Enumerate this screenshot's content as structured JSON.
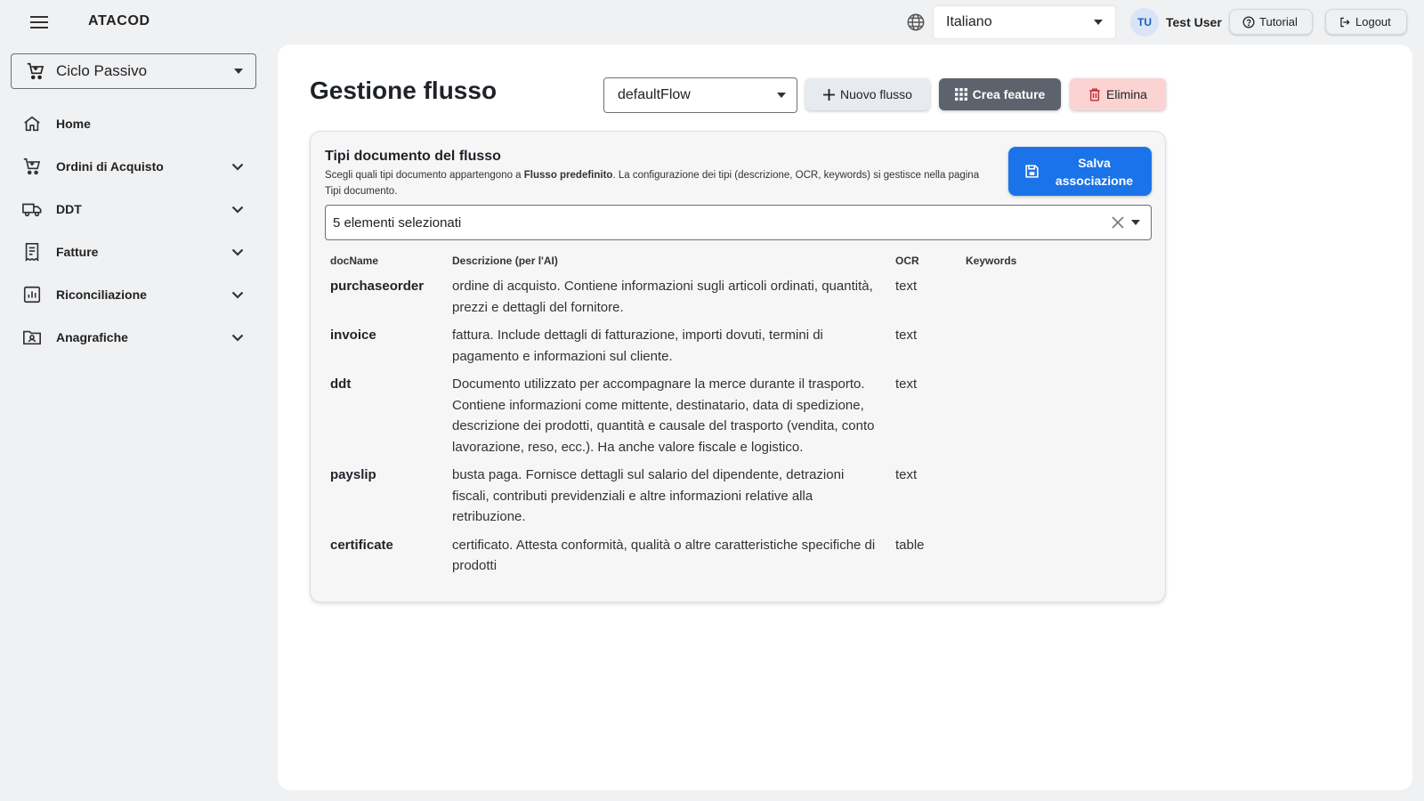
{
  "header": {
    "app_title": "ATACOD",
    "language": "Italiano",
    "avatar_initials": "TU",
    "user_name": "Test User",
    "tutorial_label": "Tutorial",
    "logout_label": "Logout"
  },
  "sidebar": {
    "context": "Ciclo Passivo",
    "items": [
      {
        "label": "Home",
        "icon": "home-icon"
      },
      {
        "label": "Ordini di Acquisto",
        "icon": "cart-icon"
      },
      {
        "label": "DDT",
        "icon": "truck-icon"
      },
      {
        "label": "Fatture",
        "icon": "receipt-icon"
      },
      {
        "label": "Riconciliazione",
        "icon": "chart-icon"
      },
      {
        "label": "Anagrafiche",
        "icon": "contact-folder-icon"
      }
    ]
  },
  "main": {
    "title": "Gestione flusso",
    "flow_selected": "defaultFlow",
    "new_flow_label": "Nuovo flusso",
    "create_feature_label": "Crea feature",
    "delete_label": "Elimina",
    "card": {
      "title": "Tipi documento del flusso",
      "desc_before": "Scegli quali tipi documento appartengono a ",
      "desc_bold": "Flusso predefinito",
      "desc_after": ". La configurazione dei tipi (descrizione, OCR, keywords) si gestisce nella pagina Tipi documento.",
      "save_label": "Salva associazione",
      "selection_summary": "5 elementi selezionati",
      "columns": [
        "docName",
        "Descrizione (per l'AI)",
        "OCR",
        "Keywords"
      ],
      "rows": [
        {
          "docName": "purchaseorder",
          "description": "ordine di acquisto. Contiene informazioni sugli articoli ordinati, quantità, prezzi e dettagli del fornitore.",
          "ocr": "text",
          "keywords": ""
        },
        {
          "docName": "invoice",
          "description": "fattura. Include dettagli di fatturazione, importi dovuti, termini di pagamento e informazioni sul cliente.",
          "ocr": "text",
          "keywords": ""
        },
        {
          "docName": "ddt",
          "description": "Documento utilizzato per accompagnare la merce durante il trasporto. Contiene informazioni come mittente, destinatario, data di spedizione, descrizione dei prodotti, quantità e causale del trasporto (vendita, conto lavorazione, reso, ecc.). Ha anche valore fiscale e logistico.",
          "ocr": "text",
          "keywords": ""
        },
        {
          "docName": "payslip",
          "description": "busta paga. Fornisce dettagli sul salario del dipendente, detrazioni fiscali, contributi previdenziali e altre informazioni relative alla retribuzione.",
          "ocr": "text",
          "keywords": ""
        },
        {
          "docName": "certificate",
          "description": "certificato. Attesta conformità, qualità o altre caratteristiche specifiche di prodotti",
          "ocr": "table",
          "keywords": ""
        }
      ]
    }
  },
  "colors": {
    "primary": "#1a73e8",
    "dark_button": "#5c636d",
    "danger_soft": "#fbd3d3",
    "background": "#f0f1f3"
  }
}
